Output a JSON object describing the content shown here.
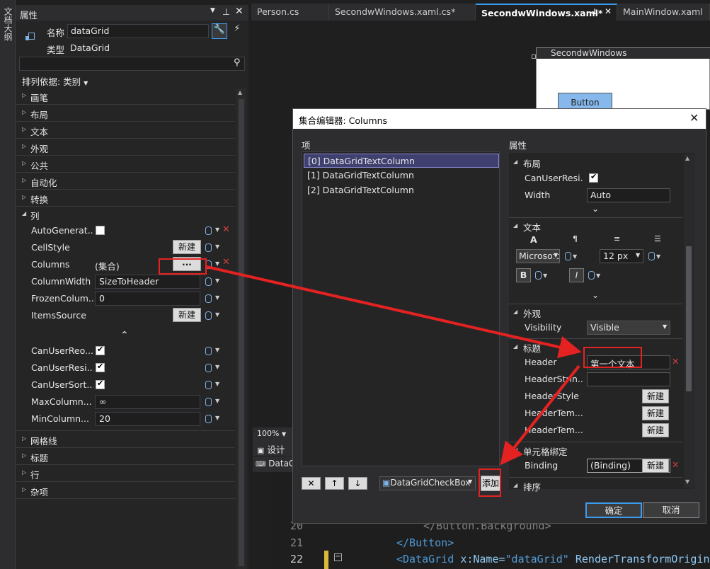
{
  "strip_label": "文档大纲",
  "props": {
    "title": "属性",
    "name_label": "名称",
    "name_value": "dataGrid",
    "type_label": "类型",
    "type_value": "DataGrid",
    "sort_label": "排列依据: 类别",
    "categories_top": [
      "画笔",
      "布局",
      "文本",
      "外观",
      "公共",
      "自动化",
      "转换"
    ],
    "expanded_category": "列",
    "rows": [
      {
        "name": "AutoGenerat...",
        "kind": "check",
        "checked": false
      },
      {
        "name": "CellStyle",
        "kind": "new",
        "value": "新建"
      },
      {
        "name": "Columns",
        "kind": "collection",
        "value": "(集合)",
        "button": "..."
      },
      {
        "name": "ColumnWidth",
        "kind": "text",
        "value": "SizeToHeader"
      },
      {
        "name": "FrozenColum...",
        "kind": "text",
        "value": "0"
      },
      {
        "name": "ItemsSource",
        "kind": "new",
        "value": "新建"
      }
    ],
    "rows2": [
      {
        "name": "CanUserReo...",
        "kind": "check",
        "checked": true
      },
      {
        "name": "CanUserResi...",
        "kind": "check",
        "checked": true
      },
      {
        "name": "CanUserSort...",
        "kind": "check",
        "checked": true
      },
      {
        "name": "MaxColumn...",
        "kind": "text",
        "value": "∞"
      },
      {
        "name": "MinColumn...",
        "kind": "text",
        "value": "20"
      }
    ],
    "categories_bottom": [
      "网格线",
      "标题",
      "行",
      "杂项"
    ]
  },
  "tabs": [
    "Person.cs",
    "SecondwWindows.xaml.cs*",
    "SecondwWindows.xaml*",
    "MainWindow.xaml"
  ],
  "designer": {
    "window_title": "SecondwWindows",
    "button_label": "Button",
    "zoom": "100%",
    "design_tab": "设计",
    "xaml_tab": "DataG"
  },
  "code": {
    "lines": [
      {
        "num": "20",
        "text": "</Button.Background>"
      },
      {
        "num": "21",
        "text": "</Button>"
      },
      {
        "num": "22",
        "text_a": "<DataGrid ",
        "attr": "x:Name=",
        "val": "\"dataGrid\"",
        "rest": " RenderTransformOrigin"
      }
    ]
  },
  "dialog": {
    "title": "集合编辑器: Columns",
    "items_label": "项",
    "items": [
      "[0] DataGridTextColumn",
      "[1] DataGridTextColumn",
      "[2] DataGridTextColumn"
    ],
    "props_label": "属性",
    "type_select": "DataGridCheckBox",
    "add_button": "添加",
    "ok_button": "确定",
    "cancel_button": "取消",
    "sections": {
      "layout": "布局",
      "text": "文本",
      "appearance": "外观",
      "header": "标题",
      "cellbinding": "单元格绑定",
      "sort": "排序"
    },
    "layout_rows": [
      {
        "name": "CanUserResi...",
        "checked": true
      },
      {
        "name": "Width",
        "value": "Auto"
      }
    ],
    "font_family": "Microsoft",
    "font_size": "12 px",
    "bold": "B",
    "italic": "I",
    "text_icons": [
      "A",
      "¶",
      "≡",
      "☰"
    ],
    "visibility_label": "Visibility",
    "visibility_value": "Visible",
    "header_rows": [
      {
        "name": "Header",
        "value": "第一个文本"
      },
      {
        "name": "HeaderStrin...",
        "value": ""
      },
      {
        "name": "HeaderStyle",
        "button": "新建"
      },
      {
        "name": "HeaderTem...",
        "button": "新建"
      },
      {
        "name": "HeaderTem...",
        "button": "新建"
      }
    ],
    "binding_label": "Binding",
    "binding_value": "(Binding)",
    "binding_button": "新建"
  },
  "colors": {
    "annotation": "#e52222",
    "accent": "#3c9cf0"
  }
}
